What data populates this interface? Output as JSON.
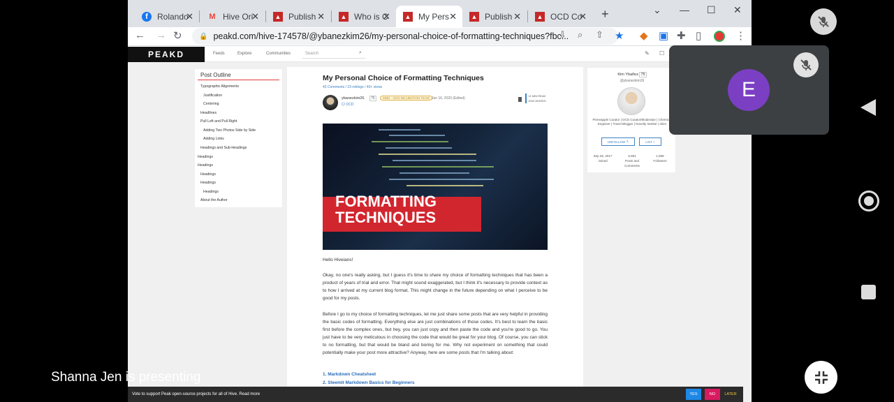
{
  "tabs": [
    {
      "label": "Rolando",
      "icon": "facebook-icon",
      "active": false
    },
    {
      "label": "Hive Ori",
      "icon": "gmail-icon",
      "active": false
    },
    {
      "label": "Publish",
      "icon": "peakd-icon",
      "active": false
    },
    {
      "label": "Who is C",
      "icon": "peakd-icon",
      "active": false
    },
    {
      "label": "My Pers",
      "icon": "peakd-icon",
      "active": true
    },
    {
      "label": "Publish",
      "icon": "peakd-icon",
      "active": false
    },
    {
      "label": "OCD Co",
      "icon": "peakd-icon",
      "active": false
    }
  ],
  "toolbar": {
    "url": "peakd.com/hive-174578/@ybanezkim26/my-personal-choice-of-formatting-techniques?fbc..."
  },
  "site": {
    "logo": "PEAKD",
    "nav": [
      "Feeds",
      "Explore",
      "Communities"
    ],
    "search_placeholder": "Search"
  },
  "outline": {
    "title": "Post Outline",
    "items": [
      "Typographic Alignments",
      "Justification",
      "Centering",
      "Headlines",
      "Pull Left and Pull Right",
      "Adding Two Photos Side by Side",
      "Adding Links",
      "Headings and Sub-Headings",
      "Headings",
      "Headings",
      "Headings",
      "Headings",
      "Headings",
      "About the Author"
    ]
  },
  "post": {
    "title": "My Personal Choice of Formatting Techniques",
    "meta": "43 Comments / 23 reblogs / 40+ views",
    "author": "ybanezkim26",
    "rep": "75",
    "badge": "MOD - OCD INCUBATION TEAM",
    "date": "Jun 16, 2020 (Edited)",
    "community": "C/ OCD",
    "read_time": "11 MIN READ",
    "word_count": "2034 WORDS",
    "hero_text_line1": "FORMATTING",
    "hero_text_line2": "TECHNIQUES",
    "greeting": "Hello Hiveians!",
    "para1": "Okay, no one's really asking, but I guess it's time to share my choice of formatting techniques that has been a product of years of trial and error. That might sound exaggerated, but I think it's necessary to provide context as to how I arrived at my current blog format. This might change in the future depending on what I perceive to be good for my posts.",
    "para2": "Before I go to my choice of formatting techniques, let me just share some posts that are very helpful in providing the basic codes of formatting. Everything else are just combinations of those codes. It's best to learn the basic first before the complex ones, but hey, you can just copy and then paste the code and you're good to go. You just have to be very meticulous in choosing the code that would be great for your blog. Of course, you can stick to no formatting, but that would be bland and boring for me. Why not experiment on something that could potentially make your post more attractive? Anyway, here are some posts that I'm talking about:",
    "links": [
      "Markdown Cheatsheet",
      "Steemit Markdown Basics for Beginners"
    ]
  },
  "profile": {
    "name": "Kim Ybañez",
    "rep": "75",
    "handle": "@ybanezkim26",
    "bio": "Pinneapple Curator | OCD Curator/Moderator | Chemical Engineer | Travel Blogger | Novelty Seeker | Alien",
    "unfollow": "UNFOLLOW",
    "list": "LIST",
    "joined_value": "Sep 25, 2017",
    "joined_label": "Joined",
    "posts_value": "5,951",
    "posts_label": "Posts and Comments",
    "followers_value": "1,808",
    "followers_label": "Followers"
  },
  "peakbar": {
    "text": "Vote to support Peak open-source projects for all of Hive. Read more",
    "yes": "YES",
    "no": "NO",
    "later": "LATER"
  },
  "meeting": {
    "participant_initial": "E",
    "presenter": "Shanna Jen is presenting"
  },
  "colors": {
    "accent": "#d2262f",
    "link": "#2a6ebb",
    "avatar": "#7b3fc4"
  }
}
